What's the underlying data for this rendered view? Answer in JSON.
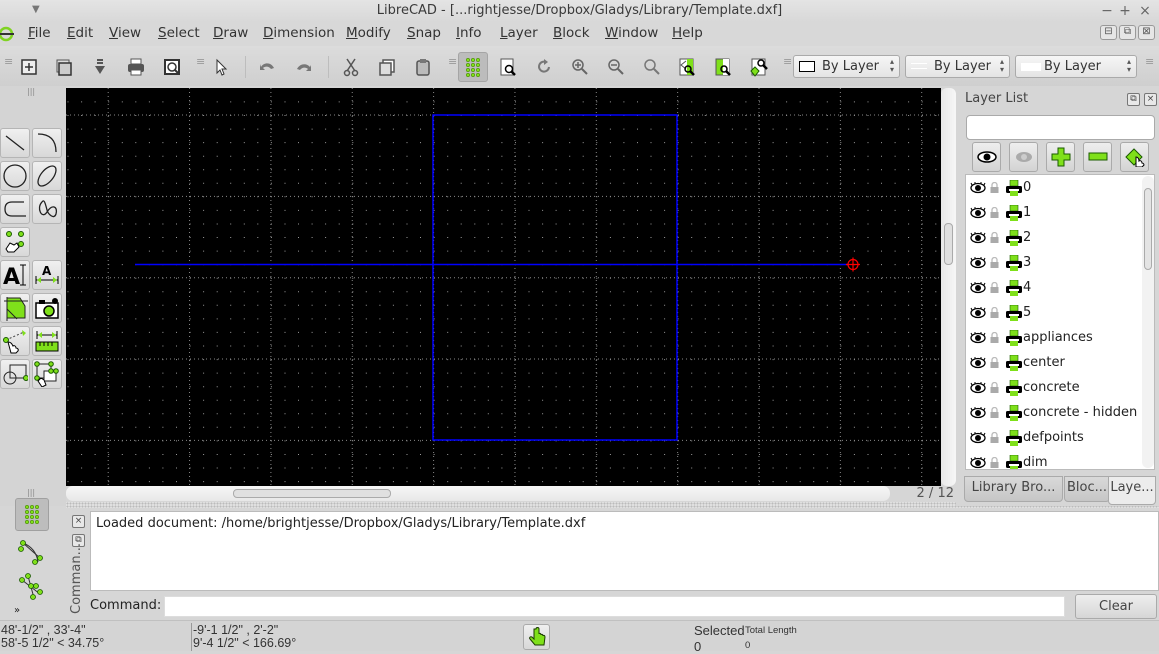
{
  "window": {
    "title": "LibreCAD - [...rightjesse/Dropbox/Gladys/Library/Template.dxf]",
    "controls": {
      "minimize": "−",
      "maximize": "+",
      "close": "×"
    }
  },
  "menubar": {
    "items": [
      {
        "label": "File",
        "u": "F",
        "rest": "ile"
      },
      {
        "label": "Edit",
        "u": "E",
        "rest": "dit"
      },
      {
        "label": "View",
        "u": "V",
        "rest": "iew"
      },
      {
        "label": "Select",
        "u": "S",
        "rest": "elect"
      },
      {
        "label": "Draw",
        "u": "D",
        "rest": "raw"
      },
      {
        "label": "Dimension",
        "u": "D",
        "rest": "imension"
      },
      {
        "label": "Modify",
        "u": "M",
        "rest": "odify"
      },
      {
        "label": "Snap",
        "u": "S",
        "rest": "nap"
      },
      {
        "label": "Info",
        "u": "I",
        "rest": "nfo"
      },
      {
        "label": "Layer",
        "u": "L",
        "rest": "ayer"
      },
      {
        "label": "Block",
        "u": "B",
        "rest": "lock"
      },
      {
        "label": "Window",
        "u": "W",
        "rest": "indow"
      },
      {
        "label": "Help",
        "u": "H",
        "rest": "elp"
      }
    ]
  },
  "toolbar": {
    "buttons": [
      "new-icon",
      "open-icon",
      "save-icon",
      "print-icon",
      "print-preview-icon",
      "select-pointer-icon",
      "undo-icon",
      "redo-icon",
      "cut-icon",
      "copy-icon",
      "paste-icon",
      "grid-icon",
      "zoom-page-icon",
      "redraw-icon",
      "zoom-in-icon",
      "zoom-out-icon",
      "zoom-auto-icon",
      "zoom-previous-icon",
      "zoom-window-icon",
      "zoom-pan-icon"
    ],
    "color_combo": "By Layer",
    "linetype_combo": "By Layer",
    "linewidth_combo": "By Layer"
  },
  "left_tools": [
    "line",
    "arc",
    "circle",
    "ellipse",
    "polyline",
    "spline",
    "point-select",
    "text",
    "dimension",
    "hatch",
    "image",
    "measure-distance",
    "measure-ruler",
    "block-insert",
    "block-select"
  ],
  "canvas": {
    "background": "#000000",
    "entity_color": "#0000ff",
    "cursor_color": "#ff0000",
    "page_indicator": "2 / 12"
  },
  "layer_list": {
    "title": "Layer List",
    "filter_value": "",
    "buttons": [
      "show-all-layers",
      "hide-all-layers",
      "add-layer",
      "remove-layer",
      "edit-layer"
    ],
    "layers": [
      "0",
      "1",
      "2",
      "3",
      "4",
      "5",
      "appliances",
      "center",
      "concrete",
      "concrete - hidden",
      "defpoints",
      "dim"
    ]
  },
  "dock_tabs": [
    {
      "label": "Library Bro...",
      "selected": false
    },
    {
      "label": "Bloc...",
      "selected": false
    },
    {
      "label": "Laye...",
      "selected": true
    }
  ],
  "snap_toolbar": [
    "snap-grid",
    "snap-endpoint",
    "snap-intersection"
  ],
  "command": {
    "dock_title": "Comman...",
    "output": "Loaded document: /home/brightjesse/Dropbox/Gladys/Library/Template.dxf",
    "label": "Command:",
    "input_value": "",
    "clear_label": "Clear"
  },
  "status": {
    "abs_coord": "48'-1/2\" , 33'-4\"",
    "abs_polar": "58'-5 1/2\" < 34.75°",
    "rel_coord": "-9'-1 1/2\" , 2'-2\"",
    "rel_polar": "9'-4 1/2\" < 166.69°",
    "selected_label": "Selected",
    "selected_value": "0",
    "total_length_label": "Total Length",
    "total_length_value": "0"
  }
}
